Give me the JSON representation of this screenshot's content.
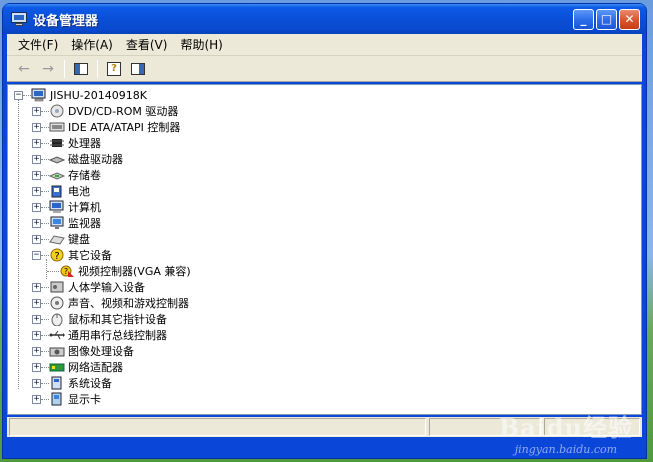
{
  "window": {
    "title": "设备管理器",
    "title_icon": "device-manager-icon"
  },
  "titlebar_buttons": {
    "minimize": "_",
    "maximize": "□",
    "close": "✕"
  },
  "menubar": [
    {
      "label": "文件(F)"
    },
    {
      "label": "操作(A)"
    },
    {
      "label": "查看(V)"
    },
    {
      "label": "帮助(H)"
    }
  ],
  "toolbar": {
    "back_icon": "back-arrow-icon",
    "forward_icon": "forward-arrow-icon",
    "show_hide_tree_icon": "console-tree-icon",
    "properties_help_icon": "help-icon",
    "action_pane_icon": "action-pane-icon",
    "back_glyph": "←",
    "forward_glyph": "→",
    "help_glyph": "?"
  },
  "tree": {
    "root": {
      "label": "JISHU-20140918K",
      "expander": "−",
      "icon": "computer-icon"
    },
    "children": [
      {
        "label": "DVD/CD-ROM 驱动器",
        "expander": "+",
        "icon": "dvd-drive-icon"
      },
      {
        "label": "IDE ATA/ATAPI 控制器",
        "expander": "+",
        "icon": "ide-controller-icon"
      },
      {
        "label": "处理器",
        "expander": "+",
        "icon": "processor-icon"
      },
      {
        "label": "磁盘驱动器",
        "expander": "+",
        "icon": "disk-drive-icon"
      },
      {
        "label": "存储卷",
        "expander": "+",
        "icon": "storage-volume-icon"
      },
      {
        "label": "电池",
        "expander": "+",
        "icon": "battery-icon"
      },
      {
        "label": "计算机",
        "expander": "+",
        "icon": "computer-icon"
      },
      {
        "label": "监视器",
        "expander": "+",
        "icon": "monitor-icon"
      },
      {
        "label": "键盘",
        "expander": "+",
        "icon": "keyboard-icon"
      },
      {
        "label": "其它设备",
        "expander": "−",
        "icon": "unknown-device-icon",
        "children": [
          {
            "label": "视频控制器(VGA 兼容)",
            "icon": "warning-device-icon"
          }
        ]
      },
      {
        "label": "人体学输入设备",
        "expander": "+",
        "icon": "hid-icon"
      },
      {
        "label": "声音、视频和游戏控制器",
        "expander": "+",
        "icon": "sound-icon"
      },
      {
        "label": "鼠标和其它指针设备",
        "expander": "+",
        "icon": "mouse-icon"
      },
      {
        "label": "通用串行总线控制器",
        "expander": "+",
        "icon": "usb-icon"
      },
      {
        "label": "图像处理设备",
        "expander": "+",
        "icon": "imaging-device-icon"
      },
      {
        "label": "网络适配器",
        "expander": "+",
        "icon": "network-adapter-icon"
      },
      {
        "label": "系统设备",
        "expander": "+",
        "icon": "system-device-icon"
      },
      {
        "label": "显示卡",
        "expander": "+",
        "icon": "display-adapter-icon"
      }
    ]
  },
  "watermark": {
    "text": "Baidu经验",
    "sub": "jingyan.baidu.com"
  },
  "colors": {
    "xp_blue": "#0a46d8",
    "chrome": "#ece9d8",
    "close_red": "#d9542c"
  }
}
